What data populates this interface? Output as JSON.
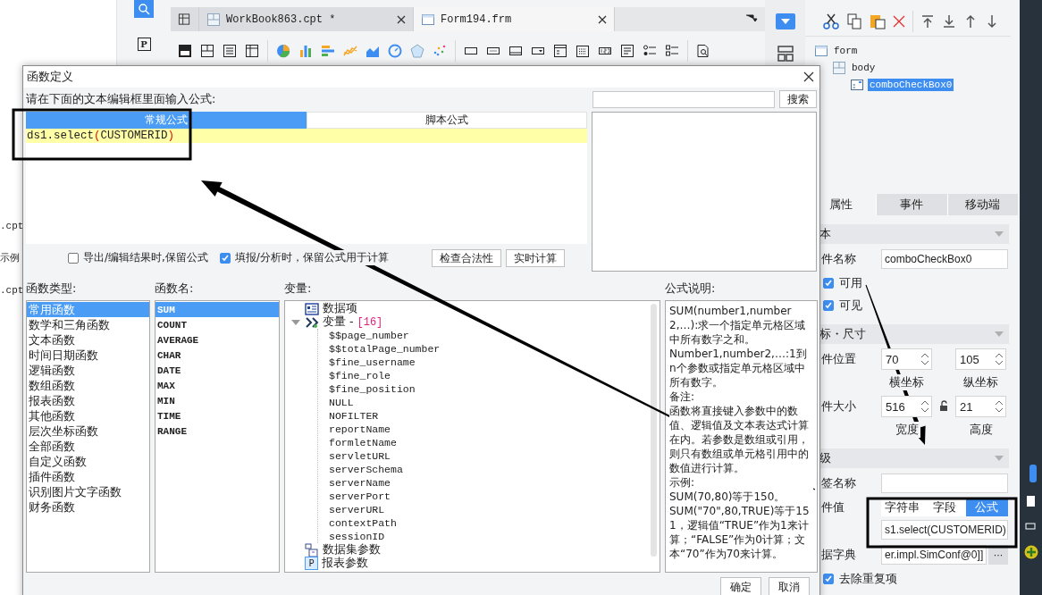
{
  "left_panel": {
    "items": [
      ".cpt",
      "示例",
      ".cpt"
    ]
  },
  "sidebar": {
    "param_key": "P"
  },
  "file_tabs": [
    {
      "label": "WorkBook863.cpt *",
      "selected": false
    },
    {
      "label": "Form194.frm",
      "selected": true
    }
  ],
  "right_panel": {
    "widget_tree": [
      {
        "label": "form",
        "kind": "form",
        "children": [
          {
            "label": "body",
            "kind": "body",
            "children": [
              {
                "label": "comboCheckBox0",
                "kind": "combo",
                "selected": true
              }
            ]
          }
        ]
      }
    ],
    "tabs": [
      {
        "label": "属性",
        "selected": true
      },
      {
        "label": "事件",
        "selected": false
      },
      {
        "label": "移动端",
        "selected": false
      }
    ],
    "rows": [
      {
        "kind": "header",
        "label": "本"
      },
      {
        "kind": "text",
        "label": "件名称",
        "value": "comboCheckBox0"
      },
      {
        "kind": "check",
        "label": "可用",
        "checked": true
      },
      {
        "kind": "check",
        "label": "可见",
        "checked": true
      },
      {
        "kind": "header",
        "label": "标・尺寸"
      },
      {
        "kind": "pair",
        "label": "件位置",
        "has_lock": false,
        "fields": [
          {
            "value": "70",
            "caption": "横坐标"
          },
          {
            "value": "105",
            "caption": "纵坐标"
          }
        ]
      },
      {
        "kind": "pair",
        "label": "件大小",
        "has_lock": true,
        "fields": [
          {
            "value": "516",
            "caption": "宽度"
          },
          {
            "value": "21",
            "caption": "高度"
          }
        ]
      },
      {
        "kind": "header",
        "label": "级"
      },
      {
        "kind": "text",
        "label": "签名称"
      },
      {
        "kind": "value",
        "label": "件值",
        "modes": [
          {
            "label": "字符串",
            "selected": false
          },
          {
            "label": "字段",
            "selected": false
          },
          {
            "label": "公式",
            "selected": true
          }
        ],
        "value": "s1.select(CUSTOMERID)"
      },
      {
        "kind": "dict",
        "label": "据字典",
        "value": "er.impl.SimConf@0]]",
        "button": "···"
      },
      {
        "kind": "check",
        "label": "去除重复项",
        "checked": true
      }
    ]
  },
  "dialog": {
    "title": "函数定义",
    "prompt": "请在下面的文本编辑框里面输入公式:",
    "search_button": "搜索",
    "formula_tabs": [
      {
        "label": "常规公式",
        "selected": true
      },
      {
        "label": "脚本公式",
        "selected": false
      }
    ],
    "formula": "ds1.select(CUSTOMERID)",
    "options": [
      {
        "label": "导出/编辑结果时,保留公式",
        "checked": false
      },
      {
        "label": "填报/分析时，保留公式用于计算",
        "checked": true
      }
    ],
    "actions": [
      "检查合法性",
      "实时计算"
    ],
    "function_types": {
      "title": "函数类型:",
      "items": [
        {
          "label": "常用函数",
          "selected": true
        },
        {
          "label": "数学和三角函数",
          "selected": false
        },
        {
          "label": "文本函数",
          "selected": false
        },
        {
          "label": "时间日期函数",
          "selected": false
        },
        {
          "label": "逻辑函数",
          "selected": false
        },
        {
          "label": "数组函数",
          "selected": false
        },
        {
          "label": "报表函数",
          "selected": false
        },
        {
          "label": "其他函数",
          "selected": false
        },
        {
          "label": "层次坐标函数",
          "selected": false
        },
        {
          "label": "全部函数",
          "selected": false
        },
        {
          "label": "自定义函数",
          "selected": false
        },
        {
          "label": "插件函数",
          "selected": false
        },
        {
          "label": "识别图片文字函数",
          "selected": false
        },
        {
          "label": "财务函数",
          "selected": false
        }
      ]
    },
    "function_names": {
      "title": "函数名:",
      "items": [
        {
          "label": "SUM",
          "selected": true
        },
        {
          "label": "COUNT",
          "selected": false
        },
        {
          "label": "AVERAGE",
          "selected": false
        },
        {
          "label": "CHAR",
          "selected": false
        },
        {
          "label": "DATE",
          "selected": false
        },
        {
          "label": "MAX",
          "selected": false
        },
        {
          "label": "MIN",
          "selected": false
        },
        {
          "label": "TIME",
          "selected": false
        },
        {
          "label": "RANGE",
          "selected": false
        }
      ]
    },
    "variables": {
      "title": "变量:",
      "tree": [
        {
          "kind": "data",
          "label": "数据项"
        },
        {
          "kind": "vars",
          "label": "变量 -",
          "count": "[16]",
          "expanded": true,
          "children": [
            {
              "label": "$$page_number"
            },
            {
              "label": "$$totalPage_number"
            },
            {
              "label": "$fine_username"
            },
            {
              "label": "$fine_role"
            },
            {
              "label": "$fine_position"
            },
            {
              "label": "NULL"
            },
            {
              "label": "NOFILTER"
            },
            {
              "label": "reportName"
            },
            {
              "label": "formletName"
            },
            {
              "label": "servletURL"
            },
            {
              "label": "serverSchema"
            },
            {
              "label": "serverName"
            },
            {
              "label": "serverPort"
            },
            {
              "label": "serverURL"
            },
            {
              "label": "contextPath"
            },
            {
              "label": "sessionID"
            }
          ]
        },
        {
          "kind": "dataset",
          "label": "数据集参数"
        },
        {
          "kind": "param",
          "label": "报表参数",
          "badge": "P"
        }
      ]
    },
    "description": {
      "title": "公式说明:",
      "paragraphs": [
        "SUM(number1,number2,…):求一个指定单元格区域中所有数字之和。",
        "Number1,number2,…:1到n个参数或指定单元格区域中所有数字。",
        "备注:",
        "函数将直接键入参数中的数值、逻辑值及文本表达式计算在内。若参数是数组或引用，则只有数组或单元格引用中的数值进行计算。",
        "示例:",
        "SUM(70,80)等于150。",
        "SUM(\"70\",80,TRUE)等于151，逻辑值“TRUE”作为1来计算；“FALSE”作为0计算；文本“70”作为70来计算。"
      ]
    },
    "buttons": [
      "确定",
      "取消"
    ]
  }
}
